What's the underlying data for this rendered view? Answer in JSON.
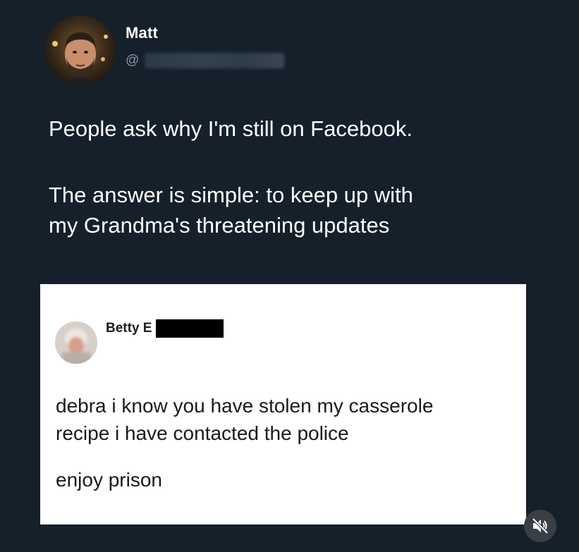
{
  "tweet": {
    "author_name": "Matt",
    "author_handle": "@",
    "text_lines": [
      "People ask why I'm still on Facebook.",
      "The answer is simple: to keep up with",
      "my Grandma's threatening updates"
    ]
  },
  "embedded_post": {
    "author_name": "Betty E",
    "text_lines": [
      "debra i know you have stolen my casserole",
      "recipe i have contacted the police",
      "enjoy prison"
    ]
  },
  "controls": {
    "mute_icon": "speaker-muted-icon"
  },
  "colors": {
    "background": "#15202b",
    "text_primary": "#ffffff",
    "text_secondary": "#8899a6",
    "card_background": "#ffffff"
  }
}
